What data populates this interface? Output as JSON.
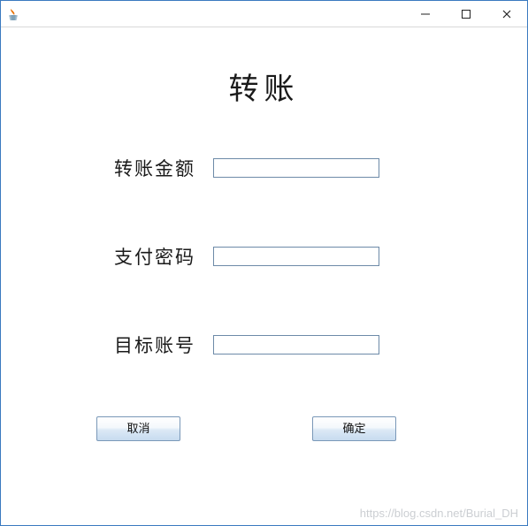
{
  "titlebar": {
    "title": ""
  },
  "form": {
    "heading": "转账",
    "amount": {
      "label": "转账金额",
      "value": ""
    },
    "password": {
      "label": "支付密码",
      "value": ""
    },
    "target": {
      "label": "目标账号",
      "value": ""
    }
  },
  "buttons": {
    "cancel": "取消",
    "ok": "确定"
  },
  "watermark": "https://blog.csdn.net/Burial_DH"
}
